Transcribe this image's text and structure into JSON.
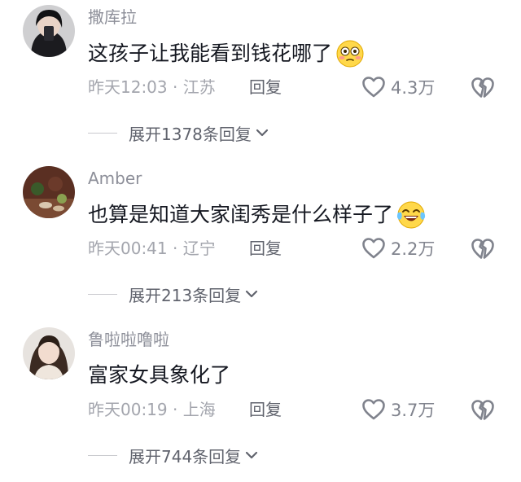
{
  "comments": [
    {
      "username": "撒库拉",
      "text": "这孩子让我能看到钱花哪了",
      "emoji": "flushed-face-emoji",
      "time_location": "昨天12:03 · 江苏",
      "reply_label": "回复",
      "likes": "4.3万",
      "expand_label": "展开1378条回复"
    },
    {
      "username": "Amber",
      "text": "也算是知道大家闺秀是什么样子了",
      "emoji": "laughing-tears-emoji",
      "time_location": "昨天00:41 · 辽宁",
      "reply_label": "回复",
      "likes": "2.2万",
      "expand_label": "展开213条回复"
    },
    {
      "username": "鲁啦啦噜啦",
      "text": "富家女具象化了",
      "emoji": "",
      "time_location": "昨天00:19 · 上海",
      "reply_label": "回复",
      "likes": "3.7万",
      "expand_label": "展开744条回复"
    }
  ],
  "colors": {
    "username": "#8d8f99",
    "text": "#151821",
    "meta": "#a3a5ad",
    "action": "#60636d"
  }
}
